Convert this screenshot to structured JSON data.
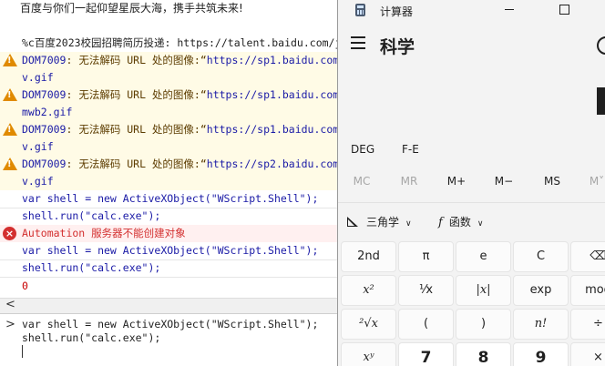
{
  "console": {
    "lines": [
      {
        "type": "log",
        "text": "百度与你们一起仰望星辰大海，携手共筑未来!"
      },
      {
        "type": "log",
        "text": "%c百度2023校园招聘简历投递: https://talent.baidu.com/jo"
      },
      {
        "type": "warn",
        "code": "DOM7009",
        "msg": ": 无法解码 URL 处的图像:“",
        "url": "https://sp1.baidu.com/"
      },
      {
        "type": "cont",
        "text": "v.gif"
      },
      {
        "type": "warn",
        "code": "DOM7009",
        "msg": ": 无法解码 URL 处的图像:“",
        "url": "https://sp1.baidu.com/"
      },
      {
        "type": "cont",
        "text": "mwb2.gif"
      },
      {
        "type": "warn",
        "code": "DOM7009",
        "msg": ": 无法解码 URL 处的图像:“",
        "url": "https://sp1.baidu.com/"
      },
      {
        "type": "cont",
        "text": "v.gif"
      },
      {
        "type": "warn",
        "code": "DOM7009",
        "msg": ": 无法解码 URL 处的图像:“",
        "url": "https://sp2.baidu.com/"
      },
      {
        "type": "cont",
        "text": "v.gif"
      },
      {
        "type": "code",
        "text": "var shell = new ActiveXObject(\"WScript.Shell\");"
      },
      {
        "type": "code",
        "text": "shell.run(\"calc.exe\");"
      },
      {
        "type": "error",
        "text": "Automation 服务器不能创建对象"
      },
      {
        "type": "code",
        "text": "var shell = new ActiveXObject(\"WScript.Shell\");"
      },
      {
        "type": "code",
        "text": "shell.run(\"calc.exe\");"
      },
      {
        "type": "result",
        "text": "0"
      }
    ],
    "scroll_arrow": "<",
    "prompt": ">",
    "input_lines": [
      "var shell = new ActiveXObject(\"WScript.Shell\");",
      "shell.run(\"calc.exe\");"
    ]
  },
  "calculator": {
    "title": "计算器",
    "mode": "科学",
    "angle_mode": "DEG",
    "fe_label": "F-E",
    "memory": [
      {
        "label": "MC",
        "enabled": false
      },
      {
        "label": "MR",
        "enabled": false
      },
      {
        "label": "M+",
        "enabled": true
      },
      {
        "label": "M−",
        "enabled": true
      },
      {
        "label": "MS",
        "enabled": true
      },
      {
        "label": "M˅",
        "enabled": false
      }
    ],
    "trig_label": "三角学",
    "func_label": "函数",
    "func_icon": "f",
    "keys": [
      [
        "2nd",
        "π",
        "e",
        "C",
        "⌫"
      ],
      [
        "x²",
        "¹⁄x",
        "|x|",
        "exp",
        "mod"
      ],
      [
        "²√x",
        "(",
        ")",
        "n!",
        "÷"
      ],
      [
        "xʸ",
        "7",
        "8",
        "9",
        "×"
      ]
    ]
  }
}
